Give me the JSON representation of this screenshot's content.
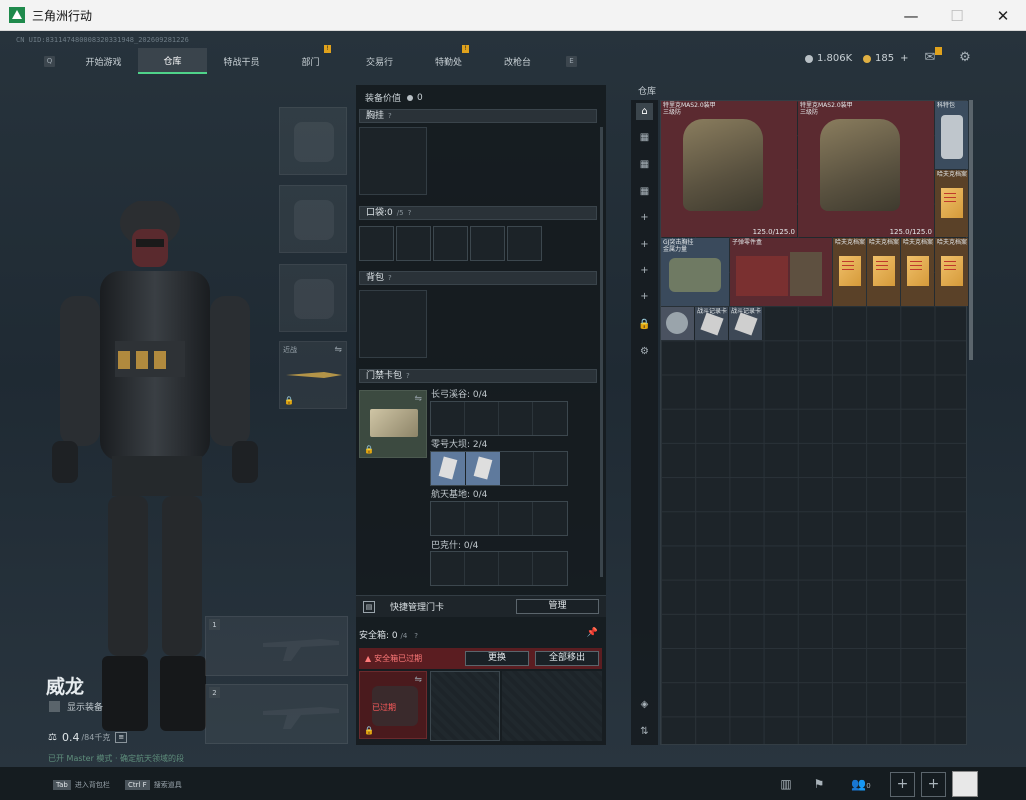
{
  "window": {
    "title": "三角洲行动",
    "min": "—",
    "max": "☐",
    "close": "✕"
  },
  "uid": "CN UID:8311474800083203319​48_20260928​1226",
  "nav": {
    "left_key": "Q",
    "right_key": "E",
    "tabs": [
      {
        "label": "开始游戏",
        "badge": ""
      },
      {
        "label": "仓库",
        "badge": ""
      },
      {
        "label": "特战干员",
        "badge": ""
      },
      {
        "label": "部门",
        "badge": "!"
      },
      {
        "label": "交易行",
        "badge": ""
      },
      {
        "label": "特勤处",
        "badge": "!"
      },
      {
        "label": "改枪台",
        "badge": ""
      }
    ],
    "active_index": 1
  },
  "currency": {
    "silver": "1.806K",
    "gold": "185",
    "gold_add": "+"
  },
  "character": {
    "name": "威龙",
    "show_equipment": "显示装备",
    "weight": "0.4",
    "weight_max": "/84千克",
    "status": "已开 Master 模式 · 确定航天领域的段"
  },
  "gear": {
    "melee_label": "近战",
    "slot_1": "1",
    "slot_2": "2"
  },
  "equipment": {
    "value_label": "装备价值",
    "value": "0",
    "chest": "胸挂",
    "pocket": "口袋:",
    "pocket_count": "0",
    "pocket_max": "/5",
    "backpack": "背包",
    "keycard_bag": "门禁卡包",
    "keycard_groups": [
      {
        "label": "长弓溪谷: 0/4",
        "items": 0
      },
      {
        "label": "零号大坝: 2/4",
        "items": 2
      },
      {
        "label": "航天基地: 0/4",
        "items": 0
      },
      {
        "label": "巴克什: 0/4",
        "items": 0
      }
    ],
    "quick_manage": "快捷管理门卡",
    "manage_button": "管理"
  },
  "safe_box": {
    "label": "安全箱:",
    "count": "0",
    "max": "/4",
    "warning": "安全箱已过期",
    "replace_button": "更换",
    "move_all_button": "全部移出",
    "expired": "已过期"
  },
  "warehouse": {
    "label": "仓库",
    "items": [
      {
        "name": "特里克MAS2.0装甲\n三级防",
        "durability": "125.0/125.0"
      },
      {
        "name": "特里克MAS2.0装甲\n三级防",
        "durability": "125.0/125.0"
      },
      {
        "name": "科特包",
        "durability": ""
      },
      {
        "name": "哈夫克档案",
        "durability": ""
      },
      {
        "name": "GJ突击胸挂\n金属力量",
        "durability": ""
      },
      {
        "name": "子弹零件盒",
        "durability": ""
      },
      {
        "name": "哈夫克档案",
        "durability": ""
      },
      {
        "name": "哈夫克档案",
        "durability": ""
      },
      {
        "name": "哈夫克档案",
        "durability": ""
      },
      {
        "name": "哈夫克档案",
        "durability": ""
      },
      {
        "name": "战斗记录卡",
        "durability": ""
      },
      {
        "name": "战斗记录卡",
        "durability": ""
      }
    ]
  },
  "bottom": {
    "tab_key": "Tab",
    "tab_hint": "进入背包栏",
    "ctrl_key": "Ctrl F",
    "ctrl_hint": "搜索道具",
    "friends_count": "0"
  }
}
